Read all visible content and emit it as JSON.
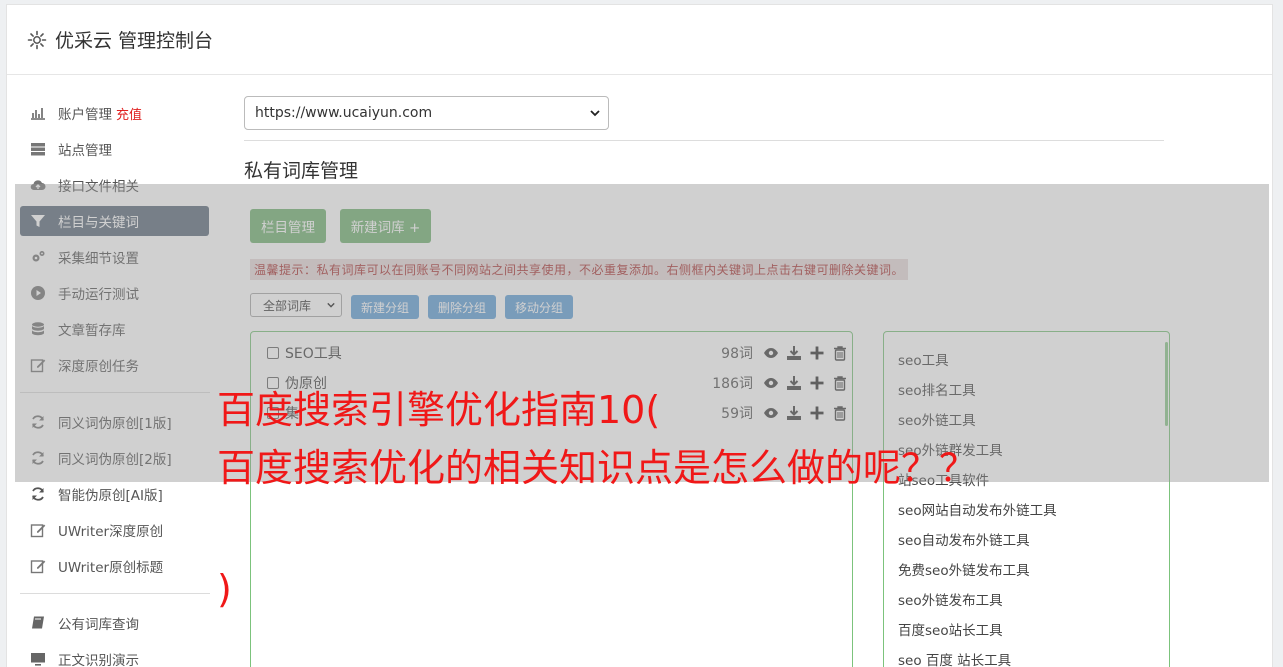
{
  "header": {
    "title": "优采云 管理控制台",
    "icon": "gear-icon"
  },
  "sidebar": {
    "items": [
      {
        "label": "账户管理",
        "badge": "充值",
        "icon": "bar-chart-icon"
      },
      {
        "label": "站点管理",
        "icon": "server-icon"
      },
      {
        "label": "接口文件相关",
        "icon": "cloud-upload-icon"
      },
      {
        "label": "栏目与关键词",
        "icon": "filter-icon",
        "active": true
      },
      {
        "label": "采集细节设置",
        "icon": "gears-icon"
      },
      {
        "label": "手动运行测试",
        "icon": "play-circle-icon"
      },
      {
        "label": "文章暂存库",
        "icon": "database-icon"
      },
      {
        "label": "深度原创任务",
        "icon": "edit-icon"
      },
      {
        "label": "同义词伪原创[1版]",
        "icon": "refresh-icon"
      },
      {
        "label": "同义词伪原创[2版]",
        "icon": "refresh-icon"
      },
      {
        "label": "智能伪原创[AI版]",
        "icon": "refresh-icon"
      },
      {
        "label": "UWriter深度原创",
        "icon": "edit-icon"
      },
      {
        "label": "UWriter原创标题",
        "icon": "edit-icon"
      },
      {
        "label": "公有词库查询",
        "icon": "book-icon"
      },
      {
        "label": "正文识别演示",
        "icon": "monitor-icon"
      }
    ]
  },
  "main": {
    "site_select": "https://www.ucaiyun.com",
    "section_title": "私有词库管理",
    "btn_columns": "栏目管理",
    "btn_new_lib": "新建词库 +",
    "tip": "温馨提示：私有词库可以在同账号不同网站之间共享使用，不必重复添加。右侧框内关键词上点击右键可删除关键词。",
    "lib_select": "全部词库",
    "btn_new_group": "新建分组",
    "btn_del_group": "删除分组",
    "btn_move_group": "移动分组",
    "libraries": [
      {
        "name": "SEO工具",
        "count": "98词"
      },
      {
        "name": "伪原创",
        "count": "186词"
      },
      {
        "name": "集",
        "count": "59词"
      }
    ],
    "keywords": [
      "seo工具",
      "seo排名工具",
      "seo外链工具",
      "seo外链群发工具",
      "站seo工具软件",
      "seo网站自动发布外链工具",
      "seo自动发布外链工具",
      "免费seo外链发布工具",
      "seo外链发布工具",
      "百度seo站长工具",
      "seo 百度 站长工具"
    ]
  },
  "overlay": {
    "line1": "百度搜索引擎优化指南10(",
    "line2": "百度搜索优化的相关知识点是怎么做的呢？？",
    "line3": ")"
  },
  "colors": {
    "green": "#73b373",
    "blue": "#62a0d8",
    "active": "#5e6c7c",
    "red": "#f01818"
  }
}
